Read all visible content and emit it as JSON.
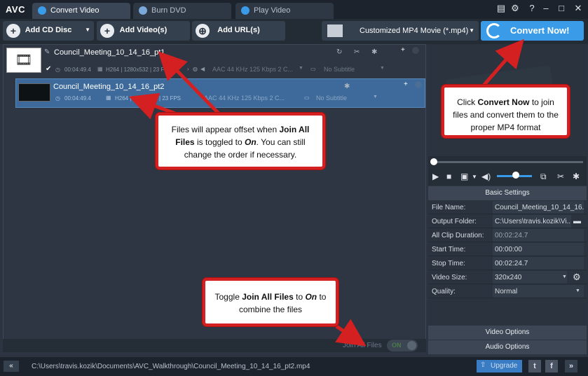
{
  "app": {
    "logo": "AVC"
  },
  "tabs": [
    {
      "label": "Convert Video"
    },
    {
      "label": "Burn DVD"
    },
    {
      "label": "Play Video"
    }
  ],
  "toolbar": {
    "add_cd": "Add CD Disc",
    "add_video": "Add Video(s)",
    "add_url": "Add URL(s)",
    "profile": "Customized MP4 Movie (*.mp4)",
    "convert": "Convert Now!"
  },
  "files": [
    {
      "name": "Council_Meeting_10_14_16_pt1",
      "duration": "00:04:49.4",
      "codec": "H264 | 1280x532 | 23 FPS",
      "audio": "AAC 44 KHz 125 Kbps 2 C...",
      "subtitle": "No Subtitle"
    },
    {
      "name": "Council_Meeting_10_14_16_pt2",
      "duration": "00:04:49.4",
      "codec": "H264 | 1280x532 | 23 FPS",
      "audio": "AAC 44 KHz 125 Kbps 2 C...",
      "subtitle": "No Subtitle"
    }
  ],
  "join": {
    "label": "Join All Files",
    "state": "ON"
  },
  "settings": {
    "header": "Basic Settings",
    "rows": [
      {
        "label": "File Name:",
        "value": "Council_Meeting_10_14_16..."
      },
      {
        "label": "Output Folder:",
        "value": "C:\\Users\\travis.kozik\\Vi..."
      },
      {
        "label": "All Clip Duration:",
        "value": "00:02:24.7"
      },
      {
        "label": "Start Time:",
        "value": "00:00:00"
      },
      {
        "label": "Stop Time:",
        "value": "00:02:24.7"
      },
      {
        "label": "Video Size:",
        "value": "320x240"
      },
      {
        "label": "Quality:",
        "value": "Normal"
      }
    ],
    "video_options": "Video Options",
    "audio_options": "Audio Options"
  },
  "status": {
    "path": "C:\\Users\\travis.kozik\\Documents\\AVC_Walkthrough\\Council_Meeting_10_14_16_pt2.mp4",
    "upgrade": "Upgrade"
  },
  "callouts": {
    "convert_pre": "Click ",
    "convert_bold": "Convert Now",
    "convert_post": " to join files and convert them to the proper MP4 format",
    "offset_pre": "Files will appear offset when ",
    "offset_bold1": "Join All Files",
    "offset_mid": " is toggled to ",
    "offset_bold2": "On",
    "offset_post": ". You can still change the order if necessary.",
    "toggle_pre": "Toggle ",
    "toggle_bold1": "Join All Files",
    "toggle_mid": " to ",
    "toggle_bold2": "On",
    "toggle_post": " to combine the files"
  },
  "colors": {
    "accent": "#3a9ce8",
    "callout_border": "#d42020",
    "selected_row": "#3d6a9a"
  }
}
